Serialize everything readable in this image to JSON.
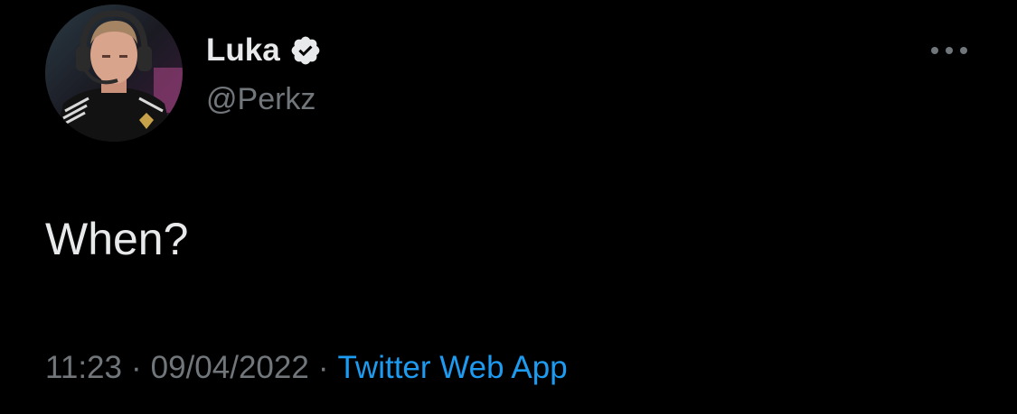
{
  "tweet": {
    "author": {
      "display_name": "Luka",
      "handle": "@Perkz",
      "verified": true,
      "avatar_icon": "profile-photo"
    },
    "text": "When?",
    "time": "11:23",
    "separator": "·",
    "date": "09/04/2022",
    "source": "Twitter Web App",
    "more_icon": "more-horizontal-icon"
  },
  "colors": {
    "background": "#000000",
    "primary_text": "#e7e9ea",
    "secondary_text": "#71767b",
    "link": "#1d9bf0",
    "verified_badge": "#e7e9ea"
  }
}
